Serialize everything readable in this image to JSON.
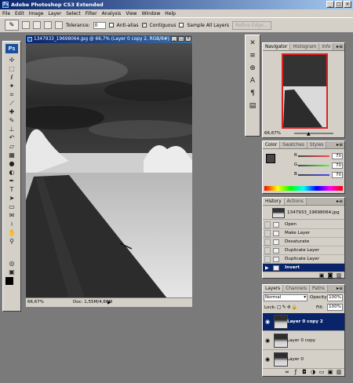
{
  "app": {
    "title": "Adobe Photoshop CS3 Extended",
    "logo_text": "Ps",
    "window_buttons": [
      "_",
      "□",
      "×"
    ]
  },
  "menu": [
    "File",
    "Edit",
    "Image",
    "Layer",
    "Select",
    "Filter",
    "Analysis",
    "View",
    "Window",
    "Help"
  ],
  "options": {
    "tolerance_label": "Tolerance:",
    "tolerance_value": "0",
    "antialias_label": "Anti-alias",
    "contiguous_label": "Contiguous",
    "sample_all_label": "Sample All Layers",
    "refine_edge_label": "Refine Edge..."
  },
  "document": {
    "title": "1347933_19698064.jpg @ 66,7% (Layer 0 copy 2, RGB/8#)",
    "zoom": "66,67%",
    "doc_info": "Doc: 1,55M/4,66M"
  },
  "navigator": {
    "tabs": [
      "Navigator",
      "Histogram",
      "Info"
    ],
    "zoom": "66,67%"
  },
  "color": {
    "tabs": [
      "Color",
      "Swatches",
      "Styles"
    ],
    "channels": [
      {
        "label": "R",
        "value": "70",
        "color": "#d02020"
      },
      {
        "label": "G",
        "value": "70",
        "color": "#20a020"
      },
      {
        "label": "B",
        "value": "70",
        "color": "#2030d0"
      }
    ]
  },
  "history": {
    "tabs": [
      "History",
      "Actions"
    ],
    "snapshot": "1347933_19698064.jpg",
    "items": [
      "Open",
      "Make Layer",
      "Desaturate",
      "Duplicate Layer",
      "Duplicate Layer",
      "Invert"
    ]
  },
  "layers": {
    "tabs": [
      "Layers",
      "Channels",
      "Paths"
    ],
    "blend_mode": "Normal",
    "opacity_label": "Opacity:",
    "opacity_value": "100%",
    "lock_label": "Lock:",
    "fill_label": "Fill:",
    "fill_value": "100%",
    "items": [
      "Layer 0 copy 2",
      "Layer 0 copy",
      "Layer 0"
    ]
  }
}
